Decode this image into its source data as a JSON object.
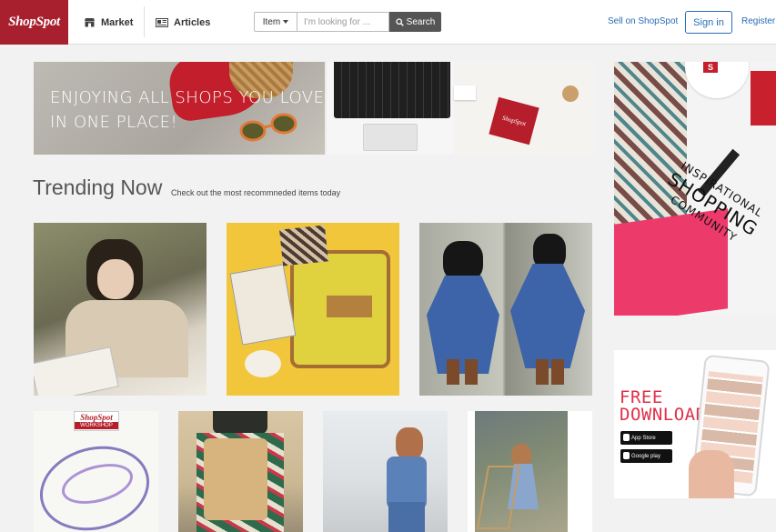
{
  "header": {
    "logo_text": "ShopSpot",
    "nav": [
      {
        "label": "Market",
        "icon": "shop-icon"
      },
      {
        "label": "Articles",
        "icon": "newspaper-icon"
      }
    ],
    "search": {
      "type_label": "Item",
      "placeholder": "I'm looking for ...",
      "button_label": "Search"
    },
    "sell_link": "Sell on ShopSpot",
    "signin_label": "Sign in",
    "register_label": "Register"
  },
  "banner": {
    "line1": "Enjoying all shops you love",
    "line2": "in one place!",
    "card_text": "ShopSpot"
  },
  "trending": {
    "title": "Trending Now",
    "subtitle": "Check out the most recommneded items today"
  },
  "workshop_card": {
    "brand": "ShopSpot",
    "label": "WORKSHOP"
  },
  "sidebar": {
    "promo": {
      "line1": "INSPIRATIONAL",
      "line2": "SHOPPING",
      "line3": "COMMUNITY",
      "cap_logo": "S"
    },
    "download": {
      "line1": "FREE",
      "line2": "DOWNLOAD",
      "appstore": "App Store",
      "googleplay": "Google play"
    }
  },
  "colors": {
    "brand": "#a8202e",
    "link": "#2a6db5",
    "accent_pink": "#e0304a"
  }
}
